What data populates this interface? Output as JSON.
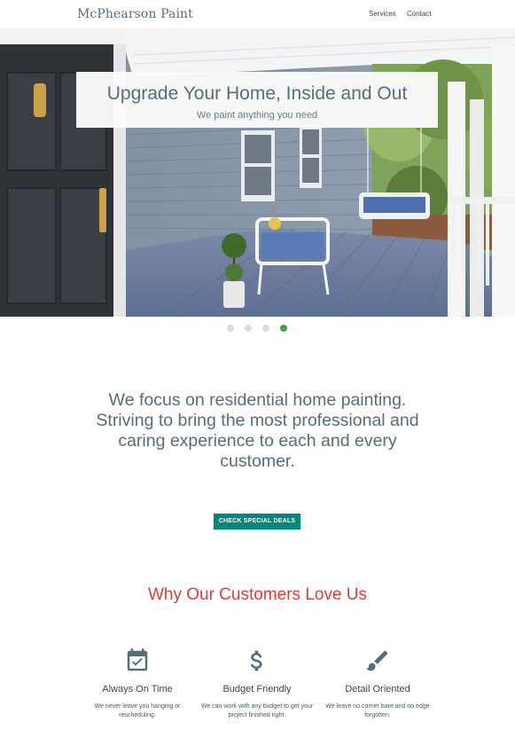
{
  "nav": {
    "logo": "McPhearson Paint",
    "links": [
      "Services",
      "Contact"
    ]
  },
  "hero": {
    "title": "Upgrade Your Home, Inside and Out",
    "subtitle": "We paint anything you need",
    "carousel": {
      "slide_count": 4,
      "active_index": 3
    }
  },
  "intro": {
    "text": "We focus on residential home painting. Striving to bring the most professional and caring experience to each and every customer."
  },
  "cta": {
    "label": "CHECK SPECIAL DEALS"
  },
  "why": {
    "heading": "Why Our Customers Love Us"
  },
  "features": [
    {
      "icon": "calendar-check-icon",
      "title": "Always On Time",
      "description": "We never leave you hanging or rescheduling."
    },
    {
      "icon": "dollar-icon",
      "title": "Budget Friendly",
      "description": "We can work with any budget to get your project finished right."
    },
    {
      "icon": "paint-brush-icon",
      "title": "Detail Oriented",
      "description": "We leave no corner bare and no edge forgotten."
    }
  ],
  "colors": {
    "text": "#546e7a",
    "accent_green": "#43a047",
    "cta_teal": "#00897b",
    "heading_red": "#e53935",
    "dot_inactive": "#dcdcdc"
  }
}
